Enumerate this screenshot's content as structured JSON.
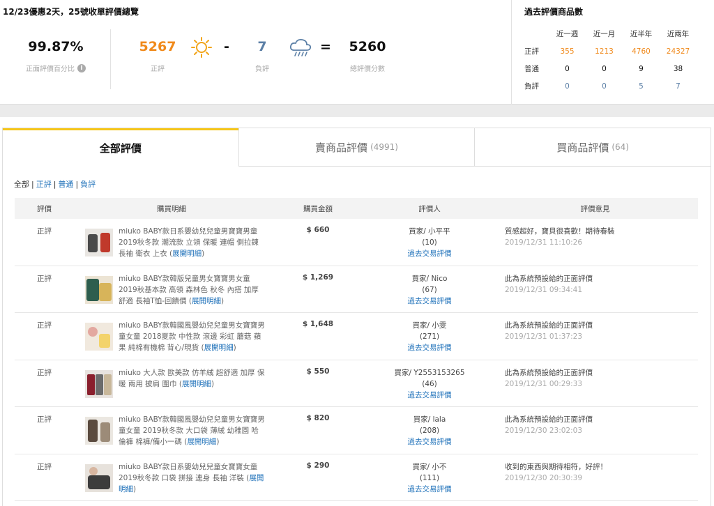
{
  "summary": {
    "title": "12/23優惠2天，25號收單評價總覽",
    "positive_pct": "99.87%",
    "positive_pct_label": "正面評價百分比",
    "positive_count": "5267",
    "positive_label": "正評",
    "minus": "-",
    "negative_count": "7",
    "negative_label": "負評",
    "equals": "=",
    "total_score": "5260",
    "total_label": "總評價分數",
    "colors": {
      "positive": "#f08a1c",
      "negative": "#5b7fa6"
    }
  },
  "past": {
    "title": "過去評價商品數",
    "headers": [
      "近一週",
      "近一月",
      "近半年",
      "近兩年"
    ],
    "rows": [
      {
        "label": "正評",
        "values": [
          "355",
          "1213",
          "4760",
          "24327"
        ],
        "color": "#f08a1c"
      },
      {
        "label": "普通",
        "values": [
          "0",
          "0",
          "9",
          "38"
        ],
        "color": "#111111"
      },
      {
        "label": "負評",
        "values": [
          "0",
          "0",
          "5",
          "7"
        ],
        "color": "#5b7fa6"
      }
    ]
  },
  "tabs": [
    {
      "label": "全部評價",
      "count": ""
    },
    {
      "label": "賣商品評價",
      "count": "(4991)"
    },
    {
      "label": "買商品評價",
      "count": "(64)"
    }
  ],
  "filters": {
    "all": "全部",
    "positive": "正評",
    "neutral": "普通",
    "negative": "負評",
    "sep": "|"
  },
  "table": {
    "headers": {
      "rate": "評價",
      "item": "購買明細",
      "amount": "購買金額",
      "rater": "評價人",
      "comment": "評價意見"
    },
    "detail_link": "展開明細",
    "history_link": "過去交易評價",
    "rows": [
      {
        "rate": "正評",
        "item": "miuko BABY款日系嬰幼兒兒童男寶寶男童 2019秋冬款 潮流款 立領 保暖 連帽 側拉鍊 長袖 衛衣 上衣",
        "amount": "$ 660",
        "rater": "買家/ 小平平",
        "rater_count": "(10)",
        "comment": "質感超好，寶貝很喜歡！期待春裝",
        "date": "2019/12/31 11:10:26"
      },
      {
        "rate": "正評",
        "item": "miuko BABY款韓版兒童男女寶寶男女童 2019秋基本款 高領 森林色 秋冬 內搭 加厚 舒適 長袖T恤-回饋價",
        "amount": "$ 1,269",
        "rater": "買家/ Nico",
        "rater_count": "(67)",
        "comment": "此為系統預設給的正面評價",
        "date": "2019/12/31 09:34:41"
      },
      {
        "rate": "正評",
        "item": "miuko BABY款韓國風嬰幼兒兒童男女寶寶男童女童 2018夏款 中性款 滾邊 彩虹 蘑菇 蘋果 純棉有機棉 背心/現貨",
        "amount": "$ 1,648",
        "rater": "買家/ 小雯",
        "rater_count": "(271)",
        "comment": "此為系統預設給的正面評價",
        "date": "2019/12/31 01:37:23"
      },
      {
        "rate": "正評",
        "item": "miuko 大人款 歐美款 仿羊絨 超舒適 加厚 保暖 兩用 披肩 圍巾",
        "amount": "$ 550",
        "rater": "買家/ Y2553153265",
        "rater_count": "(46)",
        "comment": "此為系統預設給的正面評價",
        "date": "2019/12/31 00:29:33"
      },
      {
        "rate": "正評",
        "item": "miuko BABY款韓國風嬰幼兒兒童男女寶寶男童女童 2019秋冬款 大口袋 薄絨 幼稚園 哈倫褲 棉褲/備小一碼",
        "amount": "$ 820",
        "rater": "買家/ lala",
        "rater_count": "(208)",
        "comment": "此為系統預設給的正面評價",
        "date": "2019/12/30 23:02:03"
      },
      {
        "rate": "正評",
        "item": "miuko BABY款日系嬰幼兒兒童女寶寶女童 2019秋冬款 口袋 拼接 連身 長袖 洋裝",
        "amount": "$ 290",
        "rater": "買家/ 小不",
        "rater_count": "(111)",
        "comment": "收到的東西與期待相符，好評！",
        "date": "2019/12/30 20:30:39"
      }
    ]
  }
}
